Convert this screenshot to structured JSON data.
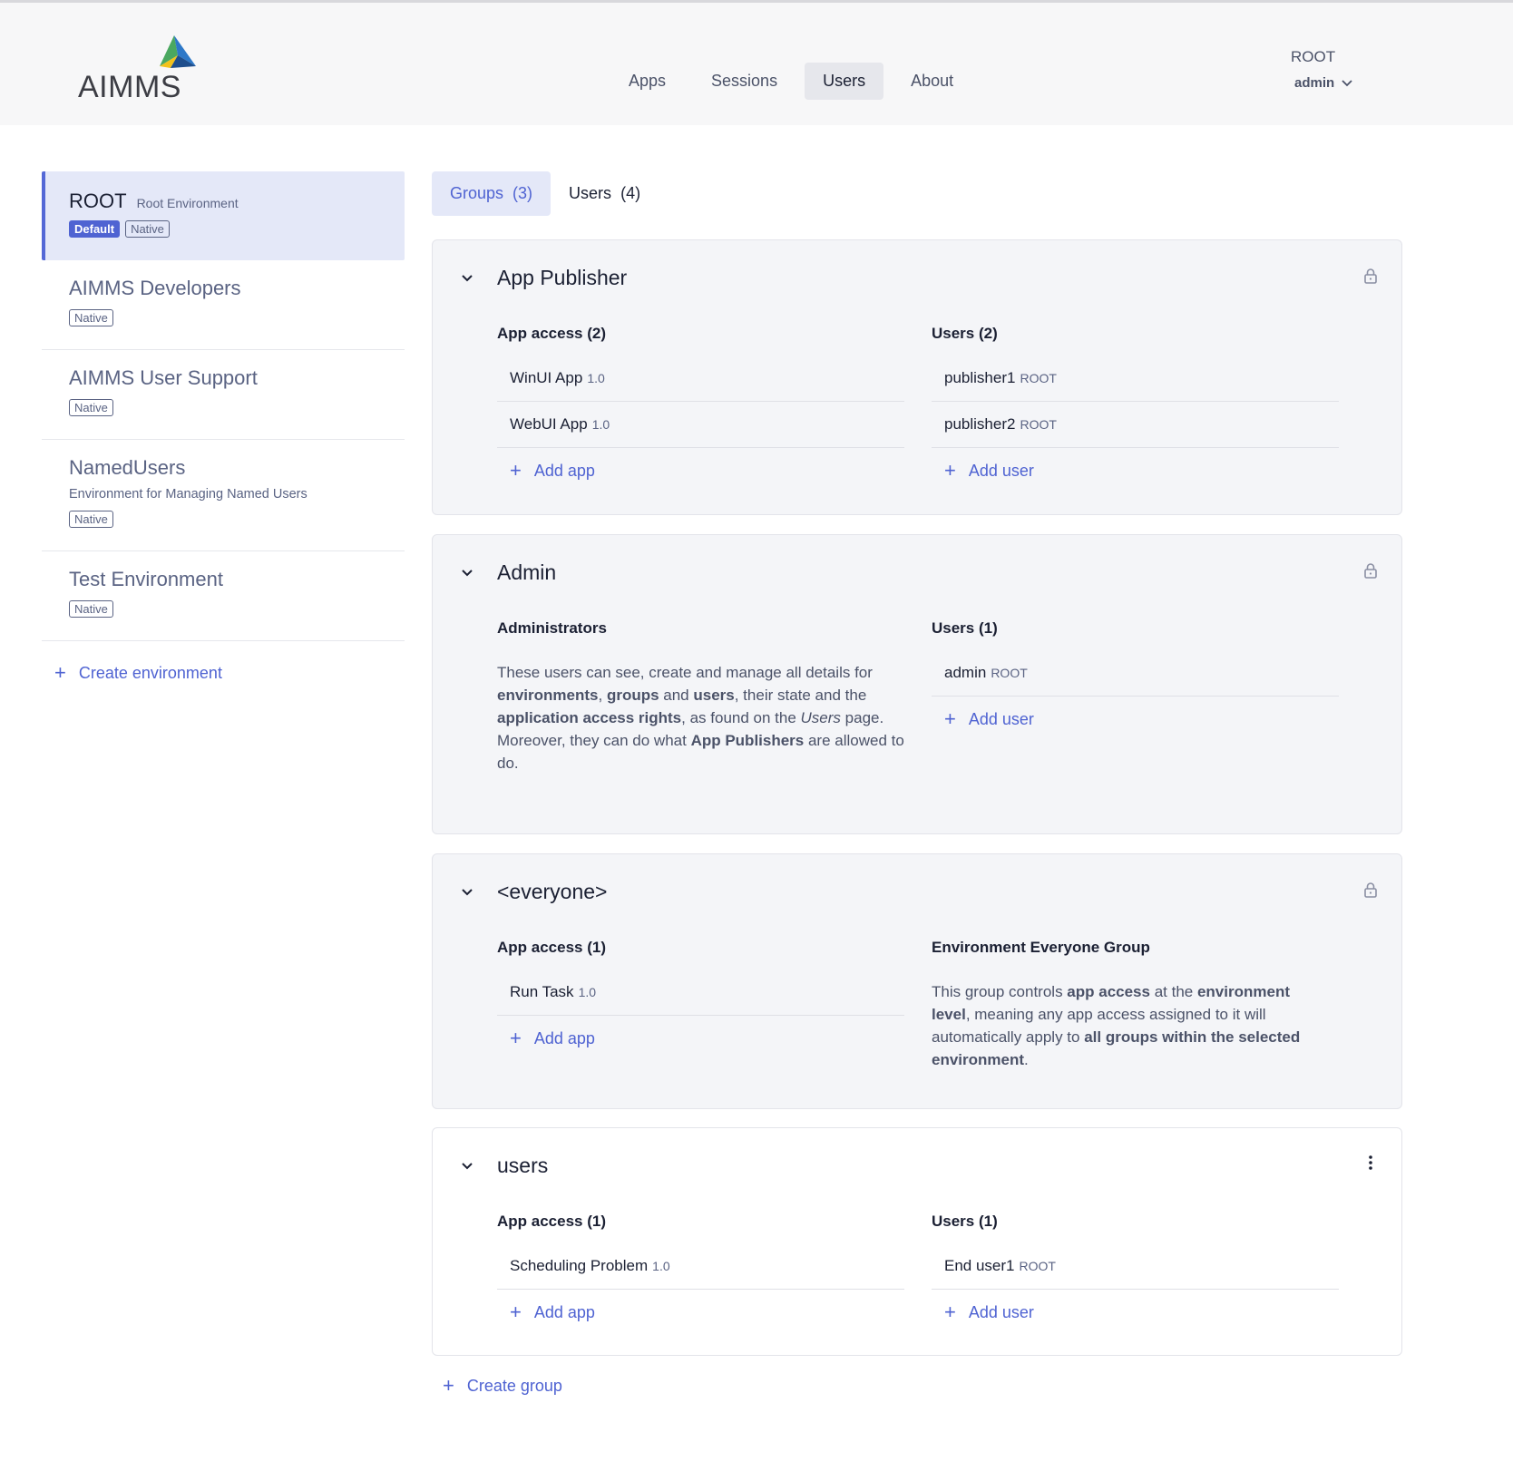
{
  "header": {
    "logo_text": "AIMMS",
    "nav": [
      "Apps",
      "Sessions",
      "Users",
      "About"
    ],
    "active_nav": "Users",
    "environment": "ROOT",
    "user": "admin"
  },
  "sidebar": {
    "environments": [
      {
        "name": "ROOT",
        "description": "Root Environment",
        "tags": [
          "Default",
          "Native"
        ]
      },
      {
        "name": "AIMMS Developers",
        "tags": [
          "Native"
        ]
      },
      {
        "name": "AIMMS User Support",
        "tags": [
          "Native"
        ]
      },
      {
        "name": "NamedUsers",
        "subtitle": "Environment for Managing Named Users",
        "tags": [
          "Native"
        ]
      },
      {
        "name": "Test Environment",
        "tags": [
          "Native"
        ]
      }
    ],
    "create_label": "Create environment"
  },
  "tabs": {
    "groups": "Groups",
    "groups_count": "(3)",
    "users": "Users",
    "users_count": "(4)"
  },
  "groups": {
    "app_publisher": {
      "title": "App Publisher",
      "left_head": "App access (2)",
      "apps": [
        {
          "name": "WinUI App",
          "version": "1.0"
        },
        {
          "name": "WebUI App",
          "version": "1.0"
        }
      ],
      "right_head": "Users (2)",
      "users": [
        {
          "name": "publisher1",
          "env": "ROOT"
        },
        {
          "name": "publisher2",
          "env": "ROOT"
        }
      ],
      "add_app": "Add app",
      "add_user": "Add user"
    },
    "admin": {
      "title": "Admin",
      "left_head": "Administrators",
      "desc": {
        "t1": "These users can see, create and manage all details for ",
        "b1": "environments",
        "t2": ", ",
        "b2": "groups",
        "t3": " and ",
        "b3": "users",
        "t4": ", their state and the ",
        "b4": "application access rights",
        "t5": ", as found on the ",
        "i1": "Users",
        "t6": " page.",
        "t7": "Moreover, they can do what ",
        "b5": "App Publishers",
        "t8": " are allowed to do."
      },
      "right_head": "Users (1)",
      "users": [
        {
          "name": "admin",
          "env": "ROOT"
        }
      ],
      "add_user": "Add user"
    },
    "everyone": {
      "title": "<everyone>",
      "left_head": "App access (1)",
      "apps": [
        {
          "name": "Run Task",
          "version": "1.0"
        }
      ],
      "add_app": "Add app",
      "right_head": "Environment Everyone Group",
      "desc": {
        "t1": "This group controls ",
        "b1": "app access",
        "t2": " at the ",
        "b2": "environment level",
        "t3": ", meaning any app access assigned to it will automatically apply to ",
        "b3": "all groups within the selected environment",
        "t4": "."
      }
    },
    "users": {
      "title": "users",
      "left_head": "App access (1)",
      "apps": [
        {
          "name": "Scheduling Problem",
          "version": "1.0"
        }
      ],
      "right_head": "Users (1)",
      "users": [
        {
          "name": "End user1",
          "env": "ROOT"
        }
      ],
      "add_app": "Add app",
      "add_user": "Add user"
    }
  },
  "create_group": "Create group",
  "colors": {
    "accent": "#4f63d2",
    "active_bg": "#e4e8f8",
    "card_bg": "#f4f5f8"
  }
}
